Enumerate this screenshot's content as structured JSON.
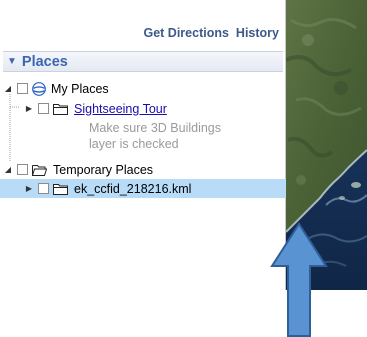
{
  "top_links": {
    "get_directions": "Get Directions",
    "history": "History"
  },
  "places_panel": {
    "title": "Places"
  },
  "tree": {
    "my_places": {
      "label": "My Places",
      "children": {
        "sightseeing_tour": {
          "label": "Sightseeing Tour",
          "description_line1": "Make sure 3D Buildings",
          "description_line2": "layer is checked"
        }
      }
    },
    "temporary_places": {
      "label": "Temporary Places",
      "children": {
        "kml_file": {
          "label": "ek_ccfid_218216.kml",
          "selected": true
        }
      }
    }
  },
  "colors": {
    "header_text": "#3b66b0",
    "link": "#1a0dab",
    "selection": "#b8dcf8",
    "arrow": "#4f86c6",
    "arrow_border": "#2e5f99"
  },
  "icons": {
    "globe": "globe-icon",
    "folder": "folder-icon",
    "open_folder": "open-folder-icon",
    "triangle_down": "triangle-down-icon",
    "triangle_right": "triangle-right-icon",
    "arrow_up": "arrow-up-icon"
  }
}
